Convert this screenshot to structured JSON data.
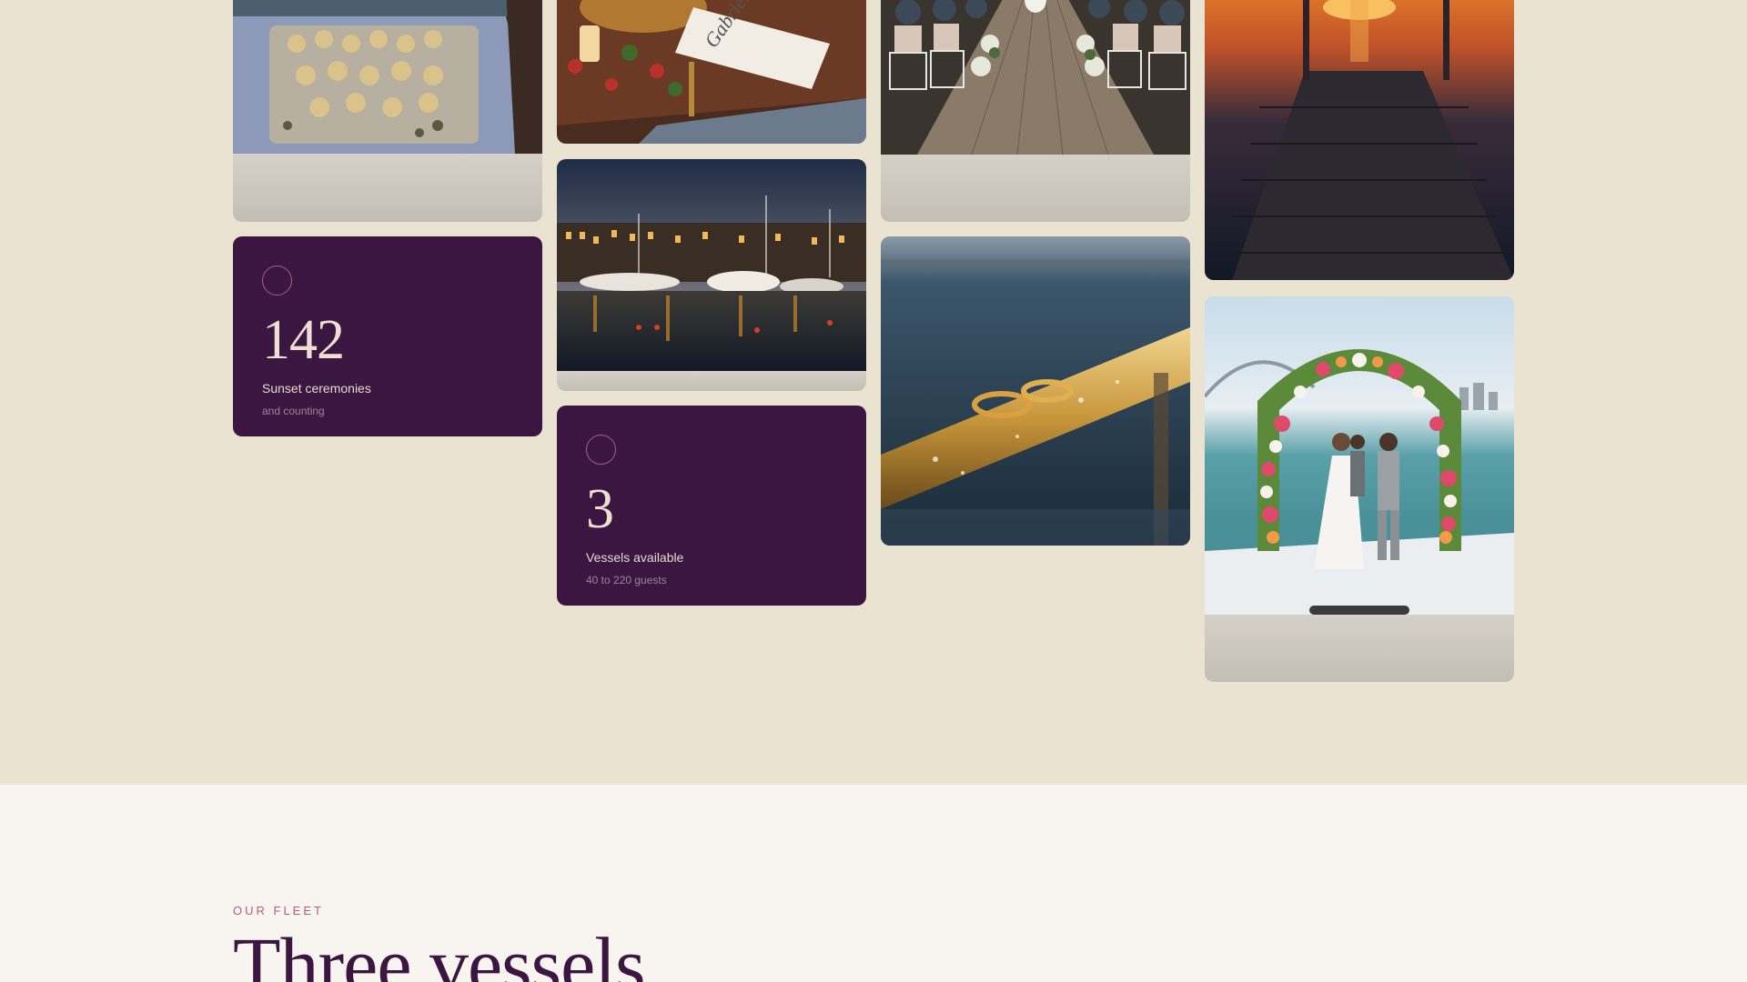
{
  "gallery": {
    "stats": [
      {
        "number": "142",
        "label": "Sunset ceremonies",
        "sub": "and counting"
      },
      {
        "number": "3",
        "label": "Vessels available",
        "sub": "40 to 220 guests"
      }
    ],
    "photos": [
      {
        "subject": "champagne-tower-photo"
      },
      {
        "subject": "place-setting-photo"
      },
      {
        "subject": "deck-ceremony-aisle-photo"
      },
      {
        "subject": "sunset-pier-photo"
      },
      {
        "subject": "harbour-at-night-photo"
      },
      {
        "subject": "wedding-rings-on-rail-photo"
      },
      {
        "subject": "floral-arch-ceremony-photo"
      }
    ]
  },
  "fleet": {
    "eyebrow": "OUR FLEET",
    "headline": "Three vessels"
  },
  "colors": {
    "background": "#ebe3d2",
    "plum": "#3b1640",
    "accent_rose": "#a8607f",
    "section_background": "#f8f5f0"
  }
}
